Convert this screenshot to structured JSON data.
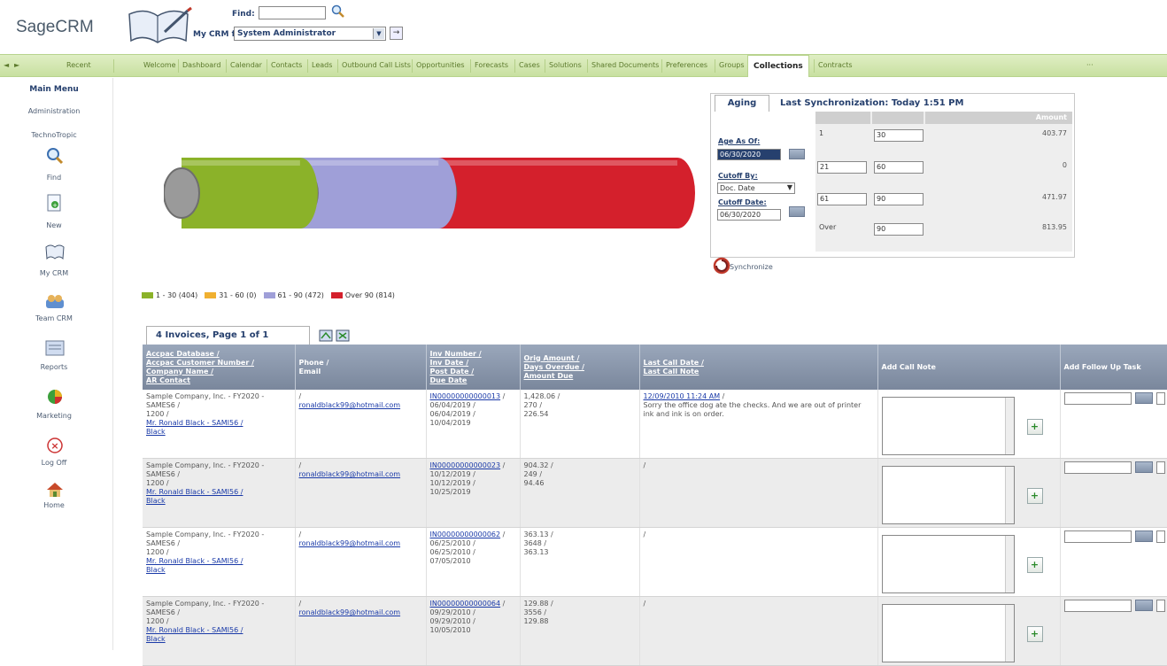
{
  "app": {
    "logo": "SageCRM"
  },
  "header": {
    "find_label": "Find:",
    "find_value": "",
    "mycrm_label": "My CRM for:",
    "mycrm_value": "System Administrator"
  },
  "nav": {
    "recent": "Recent",
    "tabs": [
      "Welcome",
      "Dashboard",
      "Calendar",
      "Contacts",
      "Leads",
      "Outbound Call Lists",
      "Opportunities",
      "Forecasts",
      "Cases",
      "Solutions",
      "Shared Documents",
      "Preferences",
      "Groups",
      "Collections",
      "Contracts"
    ],
    "active": "Collections"
  },
  "sidebar": {
    "main_menu": "Main Menu",
    "administration": "Administration",
    "technotropic": "TechnoTropic",
    "items": [
      {
        "label": "Find",
        "icon": "search-icon"
      },
      {
        "label": "New",
        "icon": "new-icon"
      },
      {
        "label": "My CRM",
        "icon": "my-crm-icon"
      },
      {
        "label": "Team CRM",
        "icon": "team-crm-icon"
      },
      {
        "label": "Reports",
        "icon": "reports-icon"
      },
      {
        "label": "Marketing",
        "icon": "marketing-icon"
      },
      {
        "label": "Log Off",
        "icon": "log-off-icon"
      },
      {
        "label": "Home",
        "icon": "home-icon"
      }
    ]
  },
  "chart_data": {
    "type": "bar",
    "categories": [
      "1 - 30",
      "31 - 60",
      "61 - 90",
      "Over 90"
    ],
    "values": [
      404,
      0,
      472,
      814
    ],
    "legend": [
      "1 - 30 (404)",
      "31 - 60 (0)",
      "61 - 90 (472)",
      "Over 90 (814)"
    ],
    "colors": [
      "#8bb229",
      "#f0b030",
      "#9f9fd8",
      "#d4202c"
    ],
    "title": "",
    "xlabel": "",
    "ylabel": "",
    "legend_position": "bottom"
  },
  "aging": {
    "tab": "Aging",
    "last_sync": "Last Synchronization: Today 1:51 PM",
    "age_as_of_label": "Age As Of:",
    "age_as_of": "06/30/2020",
    "cutoff_by_label": "Cutoff By:",
    "cutoff_by": "Doc. Date",
    "cutoff_date_label": "Cutoff Date:",
    "cutoff_date": "06/30/2020",
    "amount_header": "Amount",
    "rows": [
      {
        "from": "1",
        "to": "30",
        "amount": "403.77"
      },
      {
        "from": "21",
        "to": "60",
        "amount": "0"
      },
      {
        "from": "61",
        "to": "90",
        "amount": "471.97"
      },
      {
        "from": "Over",
        "to": "90",
        "amount": "813.95"
      }
    ],
    "synchronize": "Synchronize"
  },
  "invoices": {
    "tab": "4 Invoices, Page 1 of 1",
    "headers": {
      "col1": [
        "Accpac Database /",
        "Accpac Customer Number /",
        "Company Name /",
        "AR Contact"
      ],
      "col2": [
        "Phone /",
        "Email"
      ],
      "col3": [
        "Inv Number /",
        "Inv Date /",
        "Post Date /",
        "Due Date"
      ],
      "col4": [
        "Orig Amount /",
        "Days Overdue /",
        "Amount Due"
      ],
      "col5": [
        "Last Call Date /",
        "Last Call Note"
      ],
      "col6": "Add Call Note",
      "col7": "Add Follow Up Task"
    },
    "rows": [
      {
        "company": "Sample Company, Inc. - FY2020 - SAMES6 /",
        "num": "1200 /",
        "contact": "Mr. Ronald Black - SAMI56 /",
        "contact2": "Black",
        "phone": "/",
        "email": "ronaldblack99@hotmail.com",
        "inv": "IN00000000000013",
        "d1": "06/04/2019 /",
        "d2": "06/04/2019 /",
        "d3": "10/04/2019",
        "orig": "1,428.06 /",
        "days": "270 /",
        "due": "226.54",
        "call_date": "12/09/2010 11:24 AM",
        "call_note": "Sorry the office dog ate the checks. And we are out of printer ink and ink is on order."
      },
      {
        "company": "Sample Company, Inc. - FY2020 - SAMES6 /",
        "num": "1200 /",
        "contact": "Mr. Ronald Black - SAMI56 /",
        "contact2": "Black",
        "phone": "/",
        "email": "ronaldblack99@hotmail.com",
        "inv": "IN00000000000023",
        "d1": "10/12/2019 /",
        "d2": "10/12/2019 /",
        "d3": "10/25/2019",
        "orig": "904.32 /",
        "days": "249 /",
        "due": "94.46",
        "call_date": "",
        "call_note": ""
      },
      {
        "company": "Sample Company, Inc. - FY2020 - SAMES6 /",
        "num": "1200 /",
        "contact": "Mr. Ronald Black - SAMI56 /",
        "contact2": "Black",
        "phone": "/",
        "email": "ronaldblack99@hotmail.com",
        "inv": "IN00000000000062",
        "d1": "06/25/2010 /",
        "d2": "06/25/2010 /",
        "d3": "07/05/2010",
        "orig": "363.13 /",
        "days": "3648 /",
        "due": "363.13",
        "call_date": "",
        "call_note": ""
      },
      {
        "company": "Sample Company, Inc. - FY2020 - SAMES6 /",
        "num": "1200 /",
        "contact": "Mr. Ronald Black - SAMI56 /",
        "contact2": "Black",
        "phone": "/",
        "email": "ronaldblack99@hotmail.com",
        "inv": "IN00000000000064",
        "d1": "09/29/2010 /",
        "d2": "09/29/2010 /",
        "d3": "10/05/2010",
        "orig": "129.88 /",
        "days": "3556 /",
        "due": "129.88",
        "call_date": "",
        "call_note": ""
      }
    ]
  }
}
